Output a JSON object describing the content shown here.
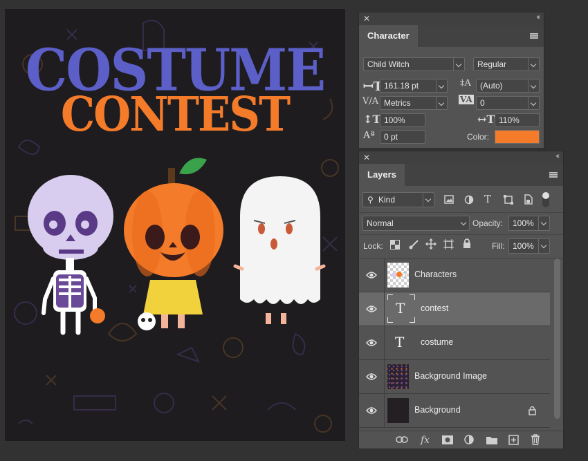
{
  "canvas": {
    "title_line1": "COSTUME",
    "title_line2": "CONTEST",
    "colors": {
      "background": "#1e1c1f",
      "title1": "#5b5fc7",
      "title2": "#f47b2a"
    }
  },
  "character_panel": {
    "tab": "Character",
    "font_family": "Child Witch",
    "font_style": "Regular",
    "font_size": "161.18 pt",
    "leading": "(Auto)",
    "kerning": "Metrics",
    "tracking": "0",
    "vertical_scale": "100%",
    "horizontal_scale": "110%",
    "baseline_shift": "0 pt",
    "color_label": "Color:",
    "color_value": "#f47b2a"
  },
  "layers_panel": {
    "tab": "Layers",
    "filter_kind": "Kind",
    "blend_mode": "Normal",
    "opacity_label": "Opacity:",
    "opacity_value": "100%",
    "lock_label": "Lock:",
    "fill_label": "Fill:",
    "fill_value": "100%",
    "layers": [
      {
        "name": "Characters",
        "type": "smart-object",
        "selected": false
      },
      {
        "name": "contest",
        "type": "text",
        "selected": true
      },
      {
        "name": "costume",
        "type": "text",
        "selected": false
      },
      {
        "name": "Background Image",
        "type": "image",
        "selected": false
      },
      {
        "name": "Background",
        "type": "background",
        "selected": false,
        "locked": true
      }
    ],
    "bottom_icons": [
      "link-icon",
      "fx-icon",
      "mask-icon",
      "adjustment-icon",
      "folder-icon",
      "new-layer-icon",
      "trash-icon"
    ],
    "bottom_labels": {
      "fx": "fx"
    }
  }
}
